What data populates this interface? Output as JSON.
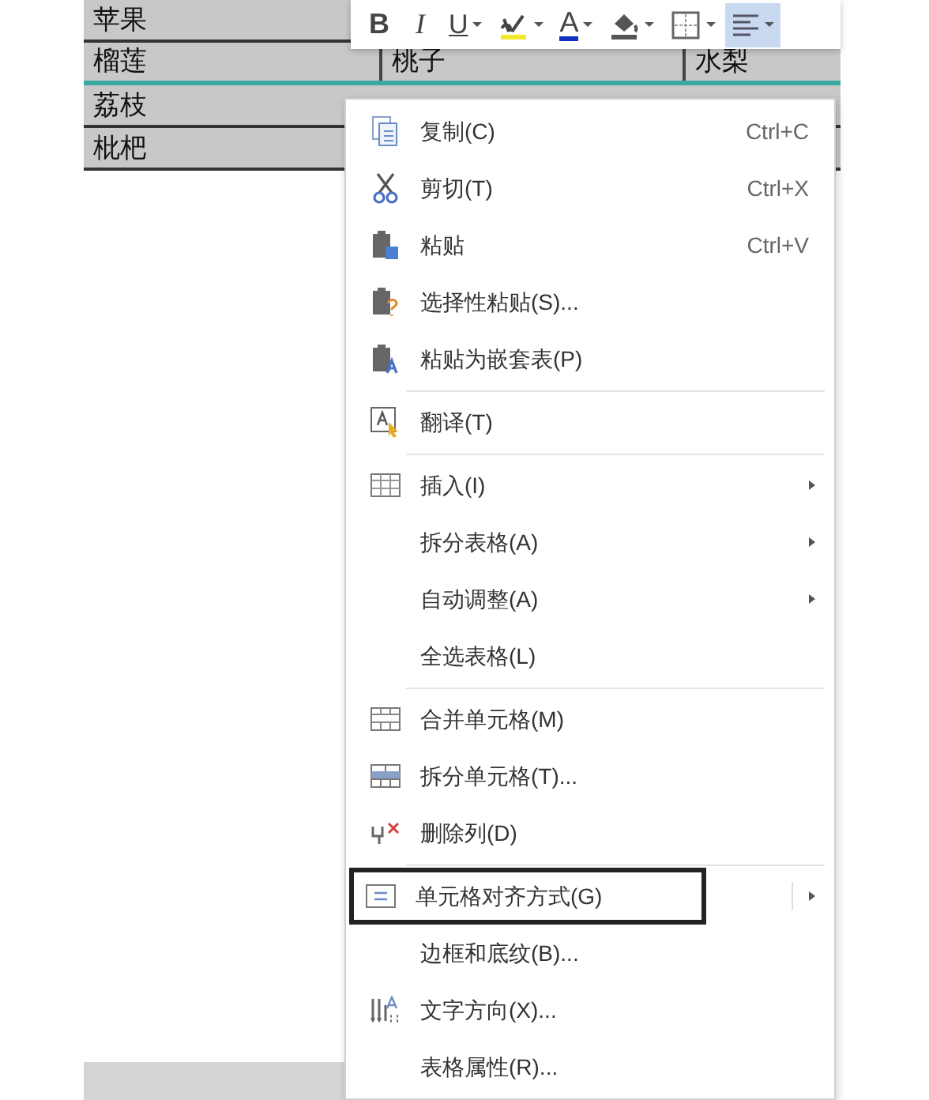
{
  "table": {
    "rows": [
      {
        "cells": [
          "苹果"
        ],
        "selected": false
      },
      {
        "cells": [
          "榴莲",
          "桃子",
          "水梨"
        ],
        "selected": true
      },
      {
        "cells": [
          "荔枝"
        ],
        "selected": false
      },
      {
        "cells": [
          "枇杷"
        ],
        "selected": false
      }
    ]
  },
  "toolbar": [
    {
      "kind": "bold",
      "label": "B",
      "dropdown": false,
      "selected": false
    },
    {
      "kind": "italic",
      "label": "I",
      "dropdown": false,
      "selected": false
    },
    {
      "kind": "underline",
      "label": "U",
      "dropdown": true,
      "selected": false
    },
    {
      "kind": "highlight",
      "dropdown": true,
      "selected": false
    },
    {
      "kind": "font-color",
      "label": "A",
      "dropdown": true,
      "selected": false
    },
    {
      "kind": "fill",
      "dropdown": true,
      "selected": false
    },
    {
      "kind": "borders",
      "dropdown": true,
      "selected": false
    },
    {
      "kind": "align",
      "dropdown": true,
      "selected": true
    }
  ],
  "context_menu": [
    {
      "kind": "copy",
      "label": "复制(C)",
      "shortcut": "Ctrl+C",
      "submenu": false,
      "selected": false
    },
    {
      "kind": "cut",
      "label": "剪切(T)",
      "shortcut": "Ctrl+X",
      "submenu": false,
      "selected": false
    },
    {
      "kind": "paste",
      "label": "粘贴",
      "shortcut": "Ctrl+V",
      "submenu": false,
      "selected": false
    },
    {
      "kind": "paste-special",
      "label": "选择性粘贴(S)...",
      "submenu": false,
      "selected": false
    },
    {
      "kind": "paste-nested",
      "label": "粘贴为嵌套表(P)",
      "submenu": false,
      "selected": false
    },
    {
      "kind": "separator"
    },
    {
      "kind": "translate",
      "label": "翻译(T)",
      "submenu": false,
      "selected": false
    },
    {
      "kind": "separator"
    },
    {
      "kind": "table",
      "label": "插入(I)",
      "submenu": true,
      "selected": false
    },
    {
      "kind": "text",
      "label": "拆分表格(A)",
      "submenu": true,
      "selected": false
    },
    {
      "kind": "text",
      "label": "自动调整(A)",
      "submenu": true,
      "selected": false
    },
    {
      "kind": "text",
      "label": "全选表格(L)",
      "submenu": false,
      "selected": false
    },
    {
      "kind": "separator"
    },
    {
      "kind": "merge",
      "label": "合并单元格(M)",
      "submenu": false,
      "selected": false
    },
    {
      "kind": "split",
      "label": "拆分单元格(T)...",
      "submenu": false,
      "selected": false
    },
    {
      "kind": "delete-column",
      "label": "删除列(D)",
      "submenu": false,
      "selected": false
    },
    {
      "kind": "separator"
    },
    {
      "kind": "align",
      "label": "单元格对齐方式(G)",
      "submenu": true,
      "selected": true
    },
    {
      "kind": "text",
      "label": "边框和底纹(B)...",
      "submenu": false,
      "selected": false
    },
    {
      "kind": "text-direction",
      "label": "文字方向(X)...",
      "submenu": false,
      "selected": false
    },
    {
      "kind": "text",
      "label": "表格属性(R)...",
      "submenu": false,
      "selected": false
    }
  ]
}
